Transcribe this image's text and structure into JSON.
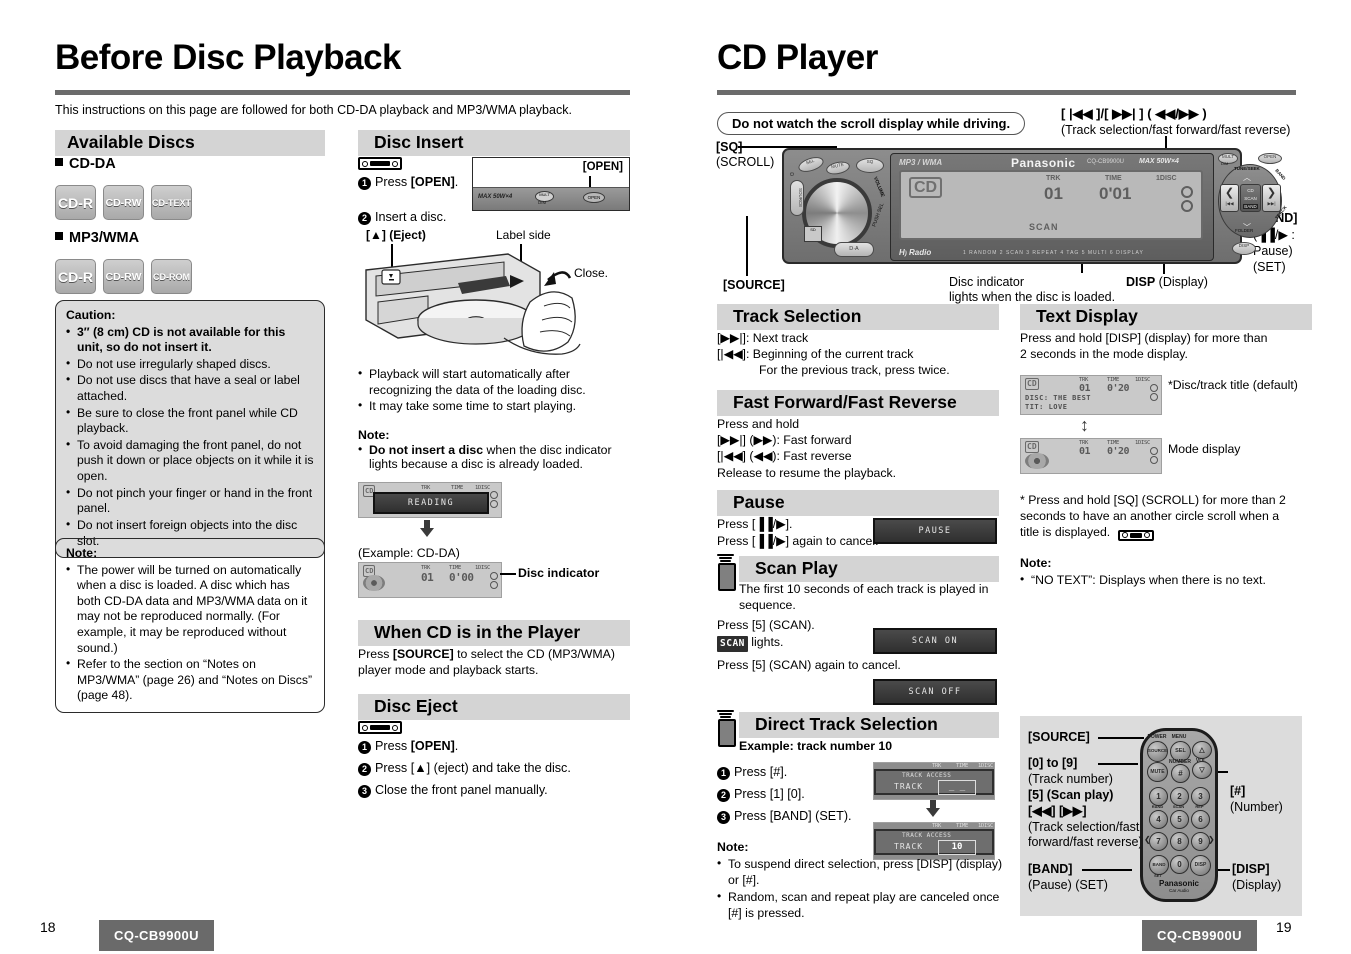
{
  "left_page": {
    "title": "Before Disc Playback",
    "intro": "This instructions on this page are followed for both CD-DA playback and MP3/WMA playback.",
    "available_discs": {
      "heading": "Available Discs",
      "cdda_label": "CD-DA",
      "cdda_badges": [
        "CD-R",
        "CD-RW",
        "CD-TEXT"
      ],
      "mp3_label": "MP3/WMA",
      "mp3_badges": [
        "CD-R",
        "CD-RW",
        "CD-ROM"
      ],
      "caution": {
        "title": "Caution:",
        "items": [
          "3″ (8 cm) CD is not available for this unit, so do not insert it.",
          "Do not use irregularly shaped discs.",
          "Do not use discs that have a seal or label attached.",
          "Be sure to close the front panel while CD playback.",
          "To avoid damaging the front panel, do not push it down or place objects on it while it is open.",
          "Do not pinch your finger or hand in the front panel.",
          "Do not insert foreign objects into the disc slot."
        ],
        "bold_first": true
      },
      "note": {
        "title": "Note:",
        "items": [
          "The power will be turned on automatically when a disc is loaded. A disc which has both CD-DA data and MP3/WMA data on it may not be reproduced normally. (For example, it may be reproduced without sound.)",
          "Refer to the section on “Notes on MP3/WMA” (page 26) and “Notes on Discs” (page 48)."
        ]
      }
    },
    "disc_insert": {
      "heading": "Disc Insert",
      "step1": "Press [OPEN].",
      "step1_bold": "OPEN",
      "step2": "Insert a disc.",
      "open_callout": "[OPEN]",
      "eject_label": "[▲] (Eject)",
      "label_side": "Label side",
      "close_label": "Close.",
      "bullets": [
        "Playback will start automatically after recognizing the data of the loading disc.",
        "It may take some time to start playing."
      ],
      "note_title": "Note:",
      "note_bold": "Do not insert a disc",
      "note_rest": " when the disc indicator lights because a disc is already loaded.",
      "reading_text": "READING",
      "example_label": "(Example: CD-DA)",
      "disc_indicator_label": "Disc indicator",
      "lcd_cd": "CD",
      "lcd_trk_label": "TRK",
      "lcd_trk_value": "01",
      "lcd_time_label": "TIME",
      "lcd_time_value": "0'00",
      "lcd_disc_label": "1DISC"
    },
    "when_cd": {
      "heading": "When CD is in the Player",
      "body_pre": "Press ",
      "body_bold": "[SOURCE]",
      "body_post": " to select the CD (MP3/WMA) player mode and playback starts."
    },
    "disc_eject": {
      "heading": "Disc Eject",
      "step1": "Press [OPEN].",
      "step2": "Press [▲] (eject) and take the disc.",
      "step3": "Close the front panel manually."
    },
    "footer": {
      "page_number": "18",
      "model": "CQ-CB9900U"
    }
  },
  "right_page": {
    "title": "CD Player",
    "warning_pill": "Do not watch the scroll display while driving.",
    "unit_labels": {
      "sq": "[SQ]",
      "scroll": "(SCROLL)",
      "source": "[SOURCE]",
      "disc_indicator_l1": "Disc indicator",
      "disc_indicator_l2": "lights when the disc is loaded.",
      "disp": "[DISP] (Display)",
      "disp_bold": "DISP",
      "track_keys_l1": "[ |◀◀ ]/[ ▶▶| ] ( ◀◀/▶▶ )",
      "track_keys_l2": "(Track selection/fast forward/fast reverse)",
      "band": "[BAND]",
      "band_sub1": "(▐▐/▶ :",
      "band_sub2": "Pause)",
      "band_sub3": "(SET)"
    },
    "unit_display": {
      "brand": "Panasonic",
      "model_small": "CQ-CB9900U",
      "power_small": "MAX 50W×4",
      "mp3wma": "MP3 / WMA",
      "hd_radio": "Radio",
      "cd": "CD",
      "trk_label": "TRK",
      "trk_value": "01",
      "time_label": "TIME",
      "time_value": "0'01",
      "disc_label": "1DISC",
      "scan": "SCAN",
      "dpad_center": "CD\nSCAN\nBAND"
    },
    "track_selection": {
      "heading": "Track Selection",
      "lines": [
        "[▶▶|]: Next track",
        "[|◀◀]: Beginning of the current track",
        "For the previous track, press twice."
      ]
    },
    "fast_forward": {
      "heading": "Fast Forward/Fast Reverse",
      "lines": [
        "Press and hold",
        "[▶▶|] (▶▶): Fast forward",
        "[|◀◀] (◀◀): Fast reverse",
        "Release to resume the playback."
      ]
    },
    "pause": {
      "heading": "Pause",
      "line1": "Press [▐▐/▶].",
      "line2": "Press [▐▐/▶] again to cancel.",
      "msg": "PAUSE"
    },
    "scan_play": {
      "heading": "Scan Play",
      "desc": "The first 10 seconds of each track is played in sequence.",
      "line1": "Press [5] (SCAN).",
      "chip": "SCAN",
      "chip_suffix": " lights.",
      "line2": "Press [5] (SCAN) again to cancel.",
      "msg_on": "SCAN ON",
      "msg_off": "SCAN OFF"
    },
    "direct_track": {
      "heading": "Direct Track Selection",
      "example": "Example: track number 10",
      "step1": "Press [#].",
      "step2": "Press [1] [0].",
      "step3": "Press [BAND] (SET).",
      "lcd_title": "TRACK ACCESS",
      "lcd_track_label": "TRACK",
      "lcd_value_empty": "_ _",
      "lcd_value_filled": "10",
      "note_title": "Note:",
      "notes": [
        "To suspend direct selection, press [DISP] (display) or [#].",
        "Random, scan and repeat play are canceled once [#] is pressed."
      ]
    },
    "text_display": {
      "heading": "Text Display",
      "line1": "Press and hold [DISP] (display) for more than",
      "line2": "2 seconds in the mode display.",
      "caption_title": "*Disc/track title (default)",
      "caption_mode": "Mode display",
      "lcd_cd": "CD",
      "lcd_trk_label": "TRK",
      "lcd_trk_value": "01",
      "lcd_time_label": "TIME",
      "lcd_time_value": "0'20",
      "lcd_disc_label": "1DISC",
      "lcd_disc_title": "DISC: THE BEST",
      "lcd_track_title": "TIT: LOVE",
      "footnote": "*  Press and hold [SQ] (SCROLL) for more than 2 seconds to have an another circle scroll when a title is displayed.",
      "note_title": "Note:",
      "note": "“NO TEXT”: Displays when there is no text."
    },
    "remote": {
      "brand": "Panasonic",
      "brand_sub": "Car Audio",
      "labels": {
        "source": "[SOURCE]",
        "digits": "[0] to [9]",
        "digits_sub1": "(Track number)",
        "digits_sub2": "[5] (Scan play)",
        "digits_sub3": "[◀◀] [▶▶]",
        "digits_sub4": "(Track selection/fast",
        "digits_sub5": "forward/fast reverse)",
        "band": "[BAND]",
        "band_sub": "(Pause) (SET)",
        "hash": "[#]",
        "hash_sub": "(Number)",
        "disp": "[DISP]",
        "disp_sub": "(Display)"
      },
      "keys": {
        "power": "POWER",
        "menu": "MENU",
        "source": "SOURCE",
        "sel": "SEL",
        "mute": "MUTE",
        "number": "NUMBER",
        "hash": "#",
        "vol": "VOL",
        "band_key": "BAND",
        "set": "SET",
        "disp": "DISP",
        "digits": [
          "1",
          "2",
          "3",
          "4",
          "5",
          "6",
          "7",
          "8",
          "9",
          "0"
        ],
        "sub1": "RAND",
        "sub2": "SCAN",
        "sub3": "REP"
      }
    },
    "footer": {
      "page_number": "19",
      "model": "CQ-CB9900U"
    }
  },
  "colors": {
    "section_head_bg": "#d4d4d4",
    "rule": "#6b6b6b",
    "chip_bg": "#6a6a6a"
  }
}
